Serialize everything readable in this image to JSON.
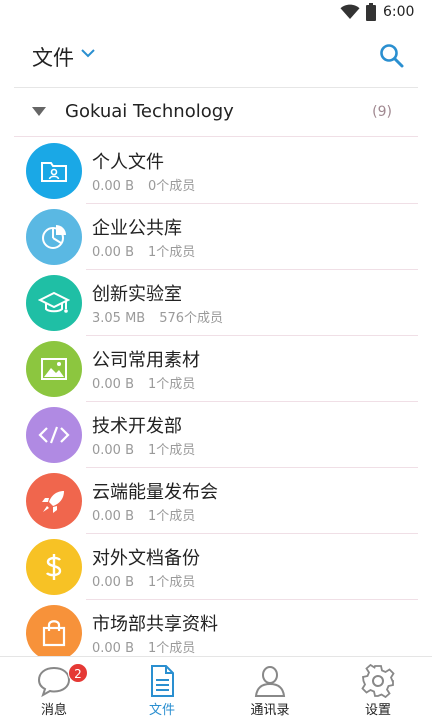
{
  "status_bar": {
    "time": "6:00"
  },
  "app_bar": {
    "title": "文件"
  },
  "group": {
    "name": "Gokuai Technology",
    "count": "(9)"
  },
  "items": [
    {
      "name": "个人文件",
      "size": "0.00 B",
      "members": "0个成员",
      "icon": "folder-user-icon",
      "color": "#1aa8e6"
    },
    {
      "name": "企业公共库",
      "size": "0.00 B",
      "members": "1个成员",
      "icon": "pie-chart-icon",
      "color": "#5ab8e3"
    },
    {
      "name": "创新实验室",
      "size": "3.05 MB",
      "members": "576个成员",
      "icon": "graduation-cap-icon",
      "color": "#1fbfa5"
    },
    {
      "name": "公司常用素材",
      "size": "0.00 B",
      "members": "1个成员",
      "icon": "image-icon",
      "color": "#8cc63f"
    },
    {
      "name": "技术开发部",
      "size": "0.00 B",
      "members": "1个成员",
      "icon": "code-icon",
      "color": "#b08ae3"
    },
    {
      "name": "云端能量发布会",
      "size": "0.00 B",
      "members": "1个成员",
      "icon": "rocket-icon",
      "color": "#f0664d"
    },
    {
      "name": "对外文档备份",
      "size": "0.00 B",
      "members": "1个成员",
      "icon": "dollar-icon",
      "color": "#f7c225"
    },
    {
      "name": "市场部共享资料",
      "size": "0.00 B",
      "members": "1个成员",
      "icon": "shopping-bag-icon",
      "color": "#f7923a"
    }
  ],
  "tabs": [
    {
      "label": "消息",
      "icon": "chat-icon",
      "badge": "2"
    },
    {
      "label": "文件",
      "icon": "document-icon",
      "active": true
    },
    {
      "label": "通讯录",
      "icon": "contact-icon"
    },
    {
      "label": "设置",
      "icon": "gear-icon"
    }
  ],
  "colors": {
    "accent": "#2a8fd0",
    "badge": "#e53935"
  }
}
